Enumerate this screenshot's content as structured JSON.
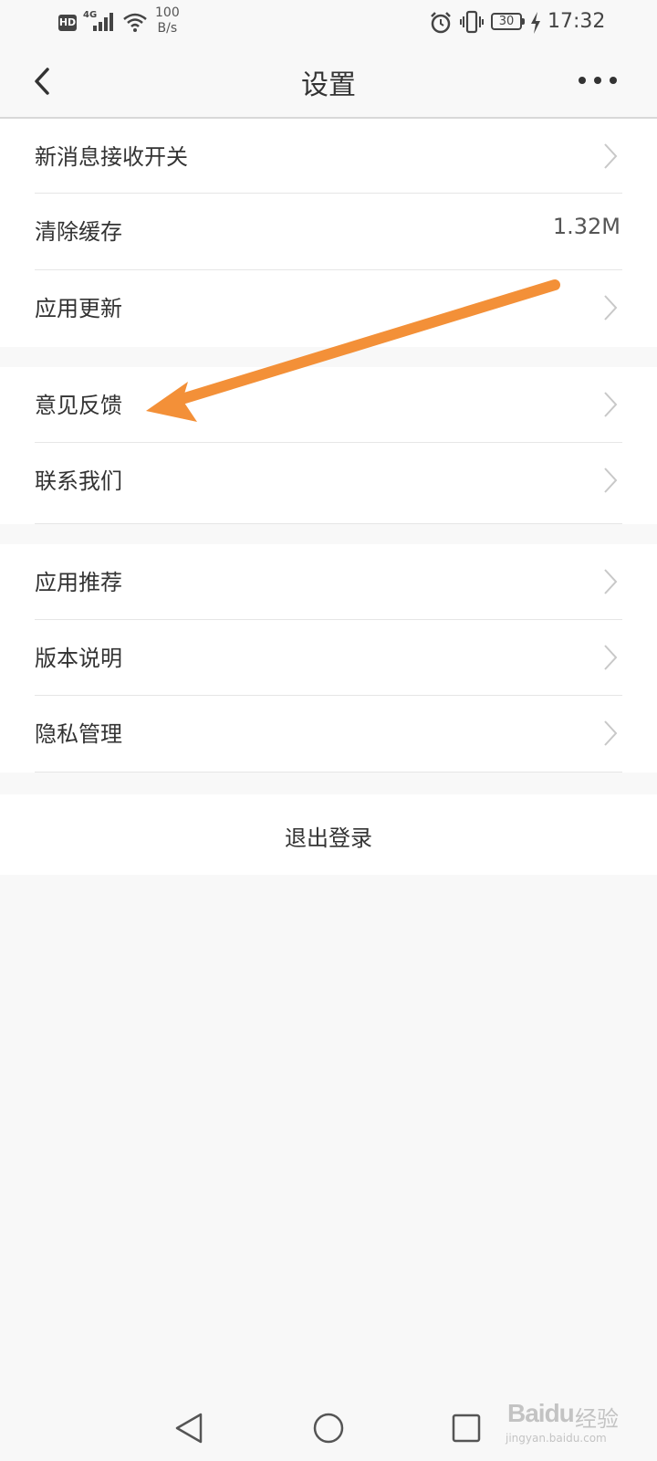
{
  "status_bar": {
    "hd": "HD",
    "network": "4G",
    "speed_value": "100",
    "speed_unit": "B/s",
    "battery": "30",
    "time": "17:32"
  },
  "header": {
    "title": "设置"
  },
  "groups": [
    {
      "items": [
        {
          "label": "新消息接收开关",
          "chevron": true
        },
        {
          "label": "清除缓存",
          "value": "1.32M"
        },
        {
          "label": "应用更新",
          "chevron": true
        }
      ]
    },
    {
      "items": [
        {
          "label": "意见反馈",
          "chevron": true
        },
        {
          "label": "联系我们",
          "chevron": true
        }
      ]
    },
    {
      "items": [
        {
          "label": "应用推荐",
          "chevron": true
        },
        {
          "label": "版本说明",
          "chevron": true
        },
        {
          "label": "隐私管理",
          "chevron": true
        }
      ]
    }
  ],
  "logout": {
    "label": "退出登录"
  },
  "annotation": {
    "arrow_color": "#f39038"
  },
  "watermark": {
    "brand": "Baidu",
    "jingyan": "经验",
    "url": "jingyan.baidu.com"
  },
  "colors": {
    "background": "#f8f8f8",
    "card": "#ffffff",
    "text": "#333333",
    "divider": "#e6e6e6"
  }
}
